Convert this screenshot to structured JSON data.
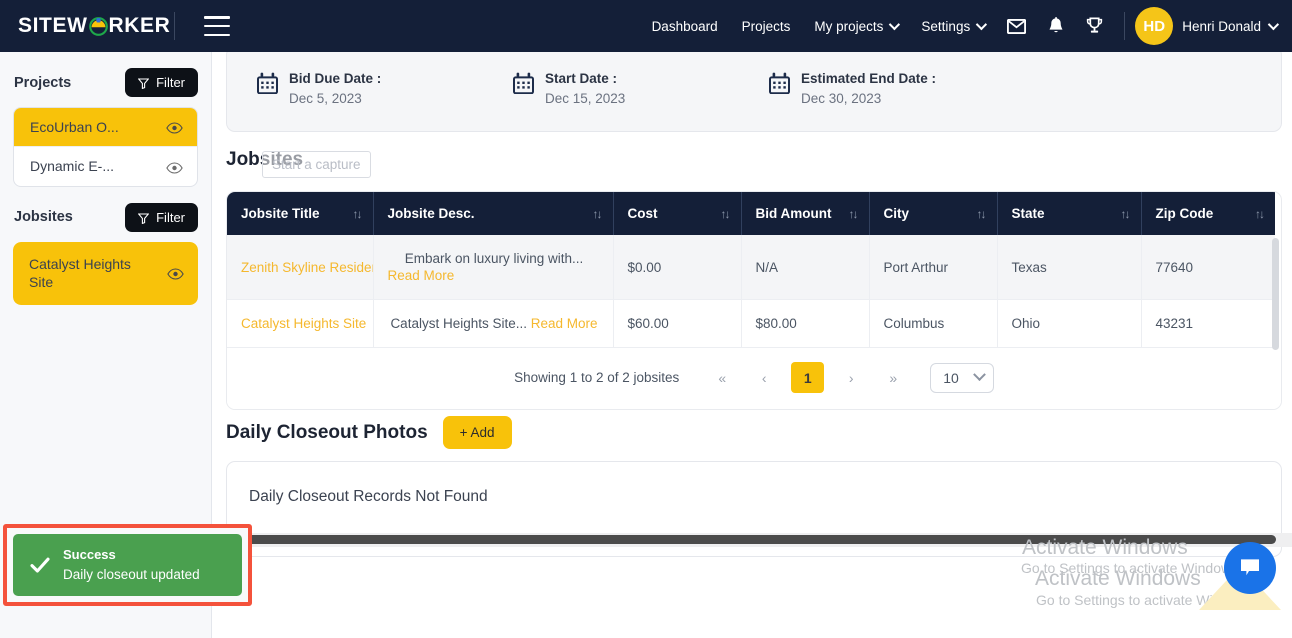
{
  "brand": {
    "name_part1": "SITEW",
    "name_part2": "RKER",
    "accent": "#f8c20a"
  },
  "topnav": {
    "menu_icon": "hamburger-icon",
    "links": [
      {
        "label": "Dashboard",
        "has_caret": false
      },
      {
        "label": "Projects",
        "has_caret": false
      },
      {
        "label": "My projects",
        "has_caret": true
      },
      {
        "label": "Settings",
        "has_caret": true
      }
    ],
    "icons": [
      "mail-icon",
      "bell-icon",
      "trophy-icon"
    ],
    "avatar_initials": "HD",
    "username": "Henri Donald"
  },
  "sidebar": {
    "projects": {
      "title": "Projects",
      "filter_label": "Filter",
      "items": [
        {
          "label": "EcoUrban O...",
          "active": true
        },
        {
          "label": "Dynamic E-...",
          "active": false
        }
      ]
    },
    "jobsites": {
      "title": "Jobsites",
      "filter_label": "Filter",
      "items": [
        {
          "label": "Catalyst Heights Site",
          "active": true
        }
      ]
    }
  },
  "dates": [
    {
      "label": "Bid Due Date :",
      "value": "Dec 5, 2023"
    },
    {
      "label": "Start Date :",
      "value": "Dec 15, 2023"
    },
    {
      "label": "Estimated End Date :",
      "value": "Dec 30, 2023"
    }
  ],
  "jobsites_section": {
    "title": "Jobsites",
    "capture_hint": "Start a capture",
    "columns": [
      "Jobsite Title",
      "Jobsite Desc.",
      "Cost",
      "Bid Amount",
      "City",
      "State",
      "Zip Code"
    ],
    "rows": [
      {
        "title": "Zenith Skyline Residen",
        "desc": "Embark on luxury living with...",
        "read_more": "Read More",
        "cost": "$0.00",
        "bid": "N/A",
        "city": "Port Arthur",
        "state": "Texas",
        "zip": "77640"
      },
      {
        "title": "Catalyst Heights Site",
        "desc": "Catalyst Heights Site...",
        "read_more": "Read More",
        "cost": "$60.00",
        "bid": "$80.00",
        "city": "Columbus",
        "state": "Ohio",
        "zip": "43231"
      }
    ],
    "pagination": {
      "showing": "Showing 1 to 2 of 2 jobsites",
      "first": "«",
      "prev": "‹",
      "current_page": "1",
      "next": "›",
      "last": "»",
      "page_size": "10"
    }
  },
  "daily_closeout": {
    "title": "Daily Closeout Photos",
    "add_label": "+ Add",
    "empty_text": "Daily Closeout Records Not Found"
  },
  "toast": {
    "title": "Success",
    "message": "Daily closeout updated",
    "color": "#4aa04f",
    "outline_color": "#f4523b"
  },
  "watermark": {
    "line1": "Activate Windows",
    "line2": "Go to Settings to activate Windows."
  }
}
